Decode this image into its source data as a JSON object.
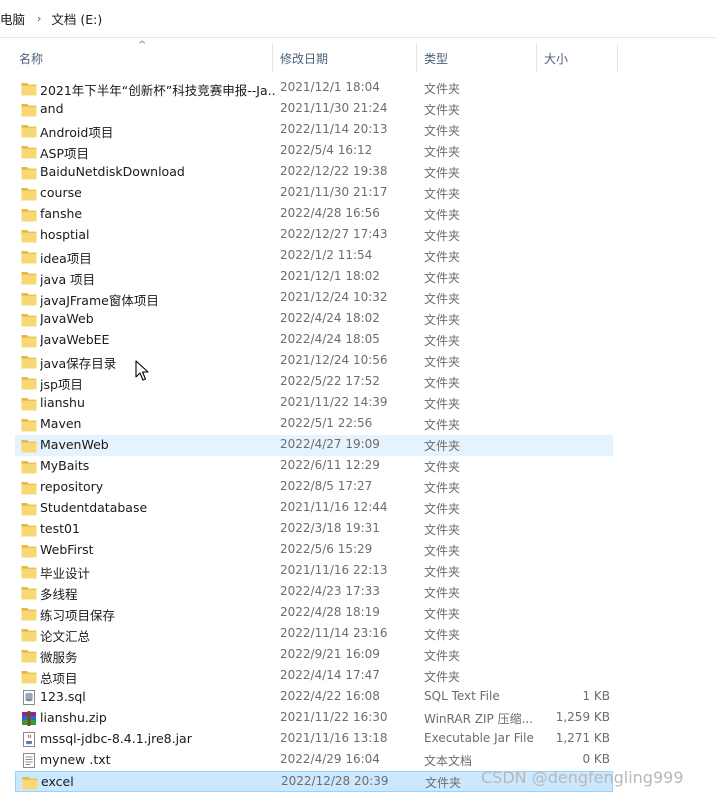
{
  "breadcrumb": {
    "parent": "电脑",
    "current": "文档 (E:)"
  },
  "columns": {
    "name": "名称",
    "date": "修改日期",
    "type": "类型",
    "size": "大小"
  },
  "rows": [
    {
      "name": "2021年下半年“创新杯”科技竞赛申报--Ja...",
      "date": "2021/12/1 18:04",
      "type": "文件夹",
      "size": "",
      "icon": "folder-icon"
    },
    {
      "name": "and",
      "date": "2021/11/30 21:24",
      "type": "文件夹",
      "size": "",
      "icon": "folder-icon"
    },
    {
      "name": "Android项目",
      "date": "2022/11/14 20:13",
      "type": "文件夹",
      "size": "",
      "icon": "folder-icon"
    },
    {
      "name": "ASP项目",
      "date": "2022/5/4 16:12",
      "type": "文件夹",
      "size": "",
      "icon": "folder-icon"
    },
    {
      "name": "BaiduNetdiskDownload",
      "date": "2022/12/22 19:38",
      "type": "文件夹",
      "size": "",
      "icon": "folder-icon"
    },
    {
      "name": "course",
      "date": "2021/11/30 21:17",
      "type": "文件夹",
      "size": "",
      "icon": "folder-icon"
    },
    {
      "name": "fanshe",
      "date": "2022/4/28 16:56",
      "type": "文件夹",
      "size": "",
      "icon": "folder-icon"
    },
    {
      "name": "hosptial",
      "date": "2022/12/27 17:43",
      "type": "文件夹",
      "size": "",
      "icon": "folder-icon"
    },
    {
      "name": "idea项目",
      "date": "2022/1/2 11:54",
      "type": "文件夹",
      "size": "",
      "icon": "folder-icon"
    },
    {
      "name": "java 项目",
      "date": "2021/12/1 18:02",
      "type": "文件夹",
      "size": "",
      "icon": "folder-icon"
    },
    {
      "name": "javaJFrame窗体项目",
      "date": "2021/12/24 10:32",
      "type": "文件夹",
      "size": "",
      "icon": "folder-icon"
    },
    {
      "name": "JavaWeb",
      "date": "2022/4/24 18:02",
      "type": "文件夹",
      "size": "",
      "icon": "folder-icon"
    },
    {
      "name": "JavaWebEE",
      "date": "2022/4/24 18:05",
      "type": "文件夹",
      "size": "",
      "icon": "folder-icon"
    },
    {
      "name": "java保存目录",
      "date": "2021/12/24 10:56",
      "type": "文件夹",
      "size": "",
      "icon": "folder-icon"
    },
    {
      "name": "jsp项目",
      "date": "2022/5/22 17:52",
      "type": "文件夹",
      "size": "",
      "icon": "folder-icon"
    },
    {
      "name": "lianshu",
      "date": "2021/11/22 14:39",
      "type": "文件夹",
      "size": "",
      "icon": "folder-icon"
    },
    {
      "name": "Maven",
      "date": "2022/5/1 22:56",
      "type": "文件夹",
      "size": "",
      "icon": "folder-icon"
    },
    {
      "name": "MavenWeb",
      "date": "2022/4/27 19:09",
      "type": "文件夹",
      "size": "",
      "icon": "folder-icon",
      "state": "hover"
    },
    {
      "name": "MyBaits",
      "date": "2022/6/11 12:29",
      "type": "文件夹",
      "size": "",
      "icon": "folder-icon"
    },
    {
      "name": "repository",
      "date": "2022/8/5 17:27",
      "type": "文件夹",
      "size": "",
      "icon": "folder-icon"
    },
    {
      "name": "Studentdatabase",
      "date": "2021/11/16 12:44",
      "type": "文件夹",
      "size": "",
      "icon": "folder-icon"
    },
    {
      "name": "test01",
      "date": "2022/3/18 19:31",
      "type": "文件夹",
      "size": "",
      "icon": "folder-icon"
    },
    {
      "name": "WebFirst",
      "date": "2022/5/6 15:29",
      "type": "文件夹",
      "size": "",
      "icon": "folder-icon"
    },
    {
      "name": "毕业设计",
      "date": "2021/11/16 22:13",
      "type": "文件夹",
      "size": "",
      "icon": "folder-icon"
    },
    {
      "name": "多线程",
      "date": "2022/4/23 17:33",
      "type": "文件夹",
      "size": "",
      "icon": "folder-icon"
    },
    {
      "name": "练习项目保存",
      "date": "2022/4/28 18:19",
      "type": "文件夹",
      "size": "",
      "icon": "folder-icon"
    },
    {
      "name": "论文汇总",
      "date": "2022/11/14 23:16",
      "type": "文件夹",
      "size": "",
      "icon": "folder-icon"
    },
    {
      "name": "微服务",
      "date": "2022/9/21 16:09",
      "type": "文件夹",
      "size": "",
      "icon": "folder-icon"
    },
    {
      "name": "总项目",
      "date": "2022/4/14 17:47",
      "type": "文件夹",
      "size": "",
      "icon": "folder-icon"
    },
    {
      "name": "123.sql",
      "date": "2022/4/22 16:08",
      "type": "SQL Text File",
      "size": "1 KB",
      "icon": "sql-file-icon"
    },
    {
      "name": "lianshu.zip",
      "date": "2021/11/22 16:30",
      "type": "WinRAR ZIP 压缩...",
      "size": "1,259 KB",
      "icon": "winrar-zip-icon"
    },
    {
      "name": "mssql-jdbc-8.4.1.jre8.jar",
      "date": "2021/11/16 13:18",
      "type": "Executable Jar File",
      "size": "1,271 KB",
      "icon": "jar-file-icon"
    },
    {
      "name": "mynew .txt",
      "date": "2022/4/29 16:04",
      "type": "文本文档",
      "size": "0 KB",
      "icon": "text-file-icon"
    },
    {
      "name": "excel",
      "date": "2022/12/28 20:39",
      "type": "文件夹",
      "size": "",
      "icon": "folder-icon",
      "state": "selected"
    }
  ],
  "watermark": "CSDN @dengfengling999",
  "colors": {
    "folder": "#f8d775",
    "folder_dark": "#e8b640",
    "hover": "#e5f3ff",
    "selected": "#cce8ff",
    "header_text": "#4c607a"
  }
}
